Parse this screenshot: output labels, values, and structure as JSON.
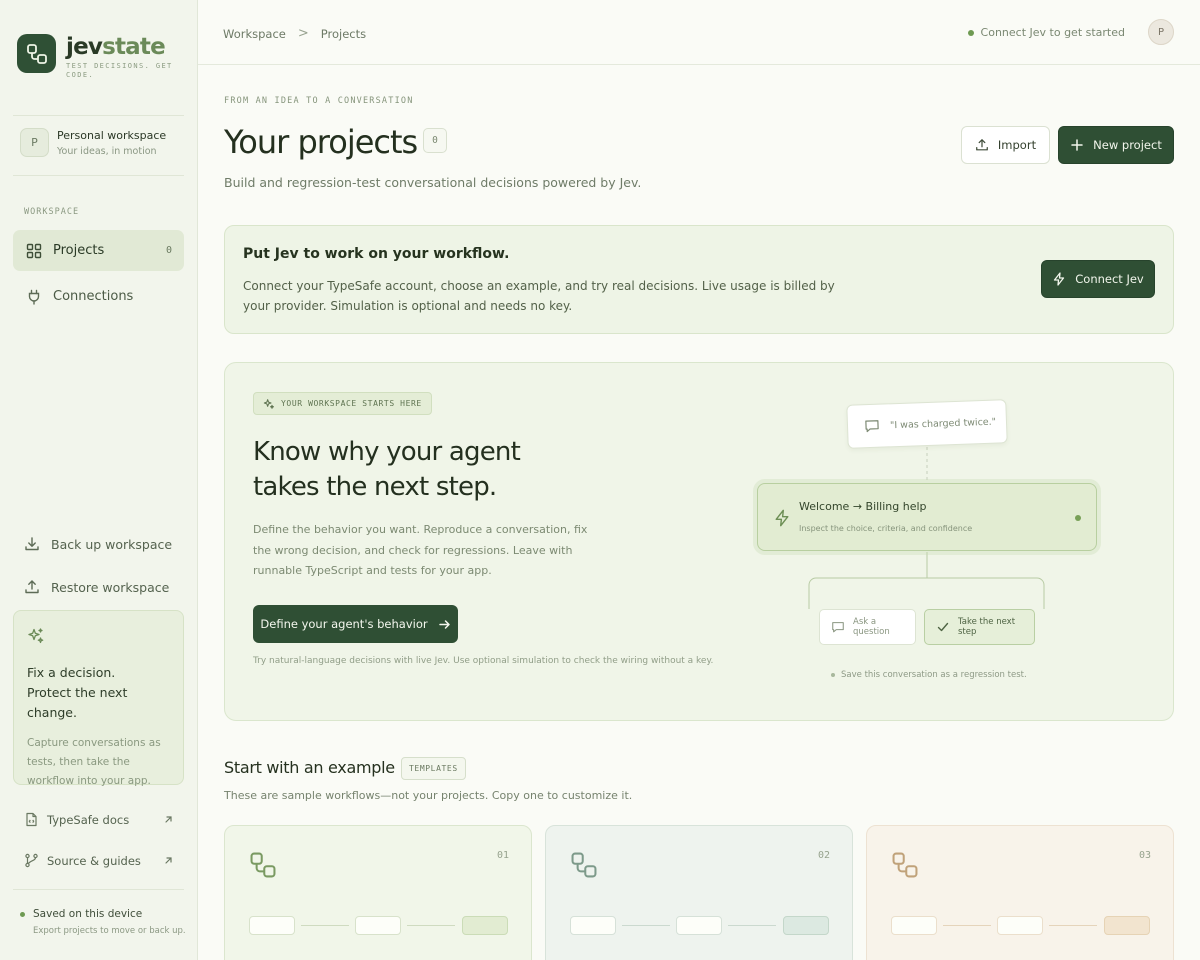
{
  "brand": {
    "name_bold": "jev",
    "name_light": "state",
    "tagline": "TEST DECISIONS. GET CODE."
  },
  "workspace_card": {
    "avatar": "P",
    "name": "Personal workspace",
    "subtitle": "Your ideas, in motion"
  },
  "sidebar": {
    "section_label": "WORKSPACE",
    "nav": [
      {
        "label": "Projects",
        "count": "0",
        "icon": "grid-icon",
        "active": true
      },
      {
        "label": "Connections",
        "icon": "plug-icon"
      }
    ],
    "utilities": [
      {
        "label": "Back up workspace",
        "icon": "download-icon"
      },
      {
        "label": "Restore workspace",
        "icon": "upload-icon"
      }
    ],
    "tip": {
      "title_line1": "Fix a decision.",
      "title_line2": "Protect the next change.",
      "body": "Capture conversations as tests, then take the workflow into your app.",
      "icon": "sparkles-icon"
    },
    "links": [
      {
        "label": "TypeSafe docs",
        "icon": "doc-icon"
      },
      {
        "label": "Source & guides",
        "icon": "branch-icon"
      }
    ],
    "saved": {
      "label": "Saved on this device",
      "subtitle": "Export projects to move or back up."
    }
  },
  "topbar": {
    "breadcrumb": [
      "Workspace",
      "Projects"
    ],
    "breadcrumb_separator": ">",
    "status": "Connect Jev to get started",
    "avatar": "P"
  },
  "header": {
    "kicker": "FROM AN IDEA TO A CONVERSATION",
    "title": "Your projects",
    "count": "0",
    "subtitle": "Build and regression-test conversational decisions powered by Jev.",
    "import_label": "Import",
    "new_label": "New project"
  },
  "banner": {
    "title": "Put Jev to work on your workflow.",
    "body": "Connect your TypeSafe account, choose an example, and try real decisions. Live usage is billed by your provider. Simulation is optional and needs no key.",
    "button": "Connect Jev"
  },
  "hero": {
    "chip": "YOUR WORKSPACE STARTS HERE",
    "title": "Know why your agent takes the next step.",
    "body": "Define the behavior you want. Reproduce a conversation, fix the wrong decision, and check for regressions. Leave with runnable TypeScript and tests for your app.",
    "button": "Define your agent's behavior",
    "note": "Try natural-language decisions with live Jev. Use optional simulation to check the wiring without a key.",
    "flow": {
      "message": "\"I was charged twice.\"",
      "node_title": "Welcome → Billing help",
      "node_subtitle": "Inspect the choice, criteria, and confidence",
      "option_a": "Ask a question",
      "option_b": "Take the next step",
      "save_note": "Save this conversation as a regression test."
    }
  },
  "examples": {
    "title": "Start with an example",
    "chip": "TEMPLATES",
    "subtitle": "These are sample workflows—not your projects. Copy one to customize it.",
    "cards": [
      {
        "number": "01",
        "accent": "#7a9a62"
      },
      {
        "number": "02",
        "accent": "#7d9a8a"
      },
      {
        "number": "03",
        "accent": "#c0a27a"
      }
    ]
  },
  "colors": {
    "brand_dark": "#2f4f34",
    "accent_green": "#6e9a52",
    "background": "#fafbf6"
  }
}
